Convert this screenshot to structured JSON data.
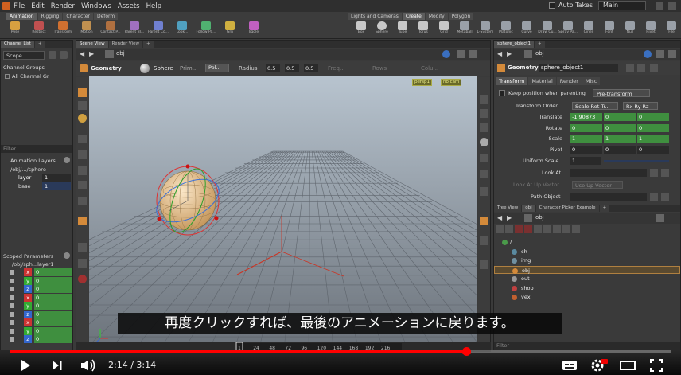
{
  "menu": {
    "items": [
      "File",
      "Edit",
      "Render",
      "Windows",
      "Assets",
      "Help"
    ],
    "auto_takes": "Auto Takes",
    "take": "Main"
  },
  "shelf": {
    "left_tabs": [
      "Animation",
      "Rigging",
      "Character",
      "Deform"
    ],
    "right_tabs": [
      "Lights and Cameras",
      "Create",
      "Modify",
      "Polygon"
    ],
    "left_tools": [
      "Pose",
      "Restrict",
      "Transform",
      "Motion",
      "Contact P...",
      "Parent Bl...",
      "Parent Co...",
      "Look...",
      "Follow Pa...",
      "Grp",
      "Jiggle"
    ],
    "right_tools": [
      "Box",
      "Sphere",
      "Tube",
      "Torus",
      "Grid",
      "Metaball",
      "L-System",
      "Platonic",
      "Curve",
      "Draw Cu...",
      "Spray Pa...",
      "Circle",
      "Font",
      "Null",
      "Rivet",
      "File"
    ]
  },
  "left": {
    "tabs": [
      "Channel List",
      "+"
    ],
    "scope_label": "Scope",
    "channel_groups_label": "Channel Groups",
    "all_channel_groups": "All Channel Gr",
    "filter_placeholder": "Filter",
    "animation_layers_label": "Animation Layers",
    "layers": [
      {
        "name": "/obj/.../sphere",
        "value": ""
      },
      {
        "name": "layer",
        "value": "1"
      },
      {
        "name": "base",
        "value": "1"
      }
    ],
    "scoped_label": "Scoped Parameters",
    "scoped_path": "/obj/sph...layer1",
    "scoped_rows": [
      {
        "axis": "x",
        "value": "0"
      },
      {
        "axis": "y",
        "value": "0"
      },
      {
        "axis": "z",
        "value": "0"
      },
      {
        "axis": "x",
        "value": "0"
      },
      {
        "axis": "y",
        "value": "0"
      },
      {
        "axis": "z",
        "value": "0"
      },
      {
        "axis": "x",
        "value": "0"
      },
      {
        "axis": "y",
        "value": "0"
      },
      {
        "axis": "z",
        "value": "0"
      }
    ]
  },
  "viewport": {
    "tabs": [
      "Scene View",
      "Render View",
      "+"
    ],
    "path": "obj",
    "context": "Geometry",
    "prim_label": "Sphere",
    "prim_sub": "Prim...",
    "poly_type": "Pol...",
    "radius_label": "Radius",
    "radius_values": [
      "0.5",
      "0.5",
      "0.5"
    ],
    "freq_label": "Freq...",
    "rows_label": "Rows",
    "cols_label": "Colu...",
    "persp": "persp1",
    "cam": "no cam"
  },
  "parms": {
    "tabs": [
      "sphere_object1",
      "+"
    ],
    "path": "obj",
    "context": "Geometry",
    "node_name": "sphere_object1",
    "sub_tabs": [
      "Transform",
      "Material",
      "Render",
      "Misc"
    ],
    "keep_position_label": "Keep position when parenting",
    "pre_transform": "Pre-transform",
    "transform_order_label": "Transform Order",
    "transform_order": "Scale Rot Tr...",
    "rot_order": "Rx Ry Rz",
    "rows": [
      {
        "label": "Translate",
        "v": [
          "-1.90873",
          "0",
          "0"
        ]
      },
      {
        "label": "Rotate",
        "v": [
          "0",
          "0",
          "0"
        ]
      },
      {
        "label": "Scale",
        "v": [
          "1",
          "1",
          "1"
        ]
      },
      {
        "label": "Pivot",
        "v": [
          "0",
          "0",
          "0"
        ]
      }
    ],
    "uniform_scale_label": "Uniform Scale",
    "uniform_scale": "1",
    "look_at_label": "Look At",
    "up_vector_label": "Look At Up Vector",
    "up_vector_value": "Use Up Vector",
    "path_object_label": "Path Object"
  },
  "tree": {
    "tabs": [
      "Tree View",
      "obj",
      "Character Picker Example",
      "+"
    ],
    "path": "obj",
    "items": [
      "/",
      "ch",
      "img",
      "obj",
      "out",
      "shop",
      "vex"
    ],
    "filter_placeholder": "Filter"
  },
  "timeline": {
    "ticks": [
      "1",
      "24",
      "48",
      "72",
      "96",
      "120",
      "144",
      "168",
      "192",
      "216"
    ],
    "start": "1",
    "end": "240",
    "current": "1"
  },
  "subtitle": "再度クリックすれば、最後のアニメーションに戻ります。",
  "player": {
    "current_time": "2:14",
    "duration": "3:14",
    "progress": 0.69
  },
  "colors": {
    "accent": "#d06020",
    "green_field": "#3f8f3f",
    "youtube_red": "#ff0000"
  }
}
